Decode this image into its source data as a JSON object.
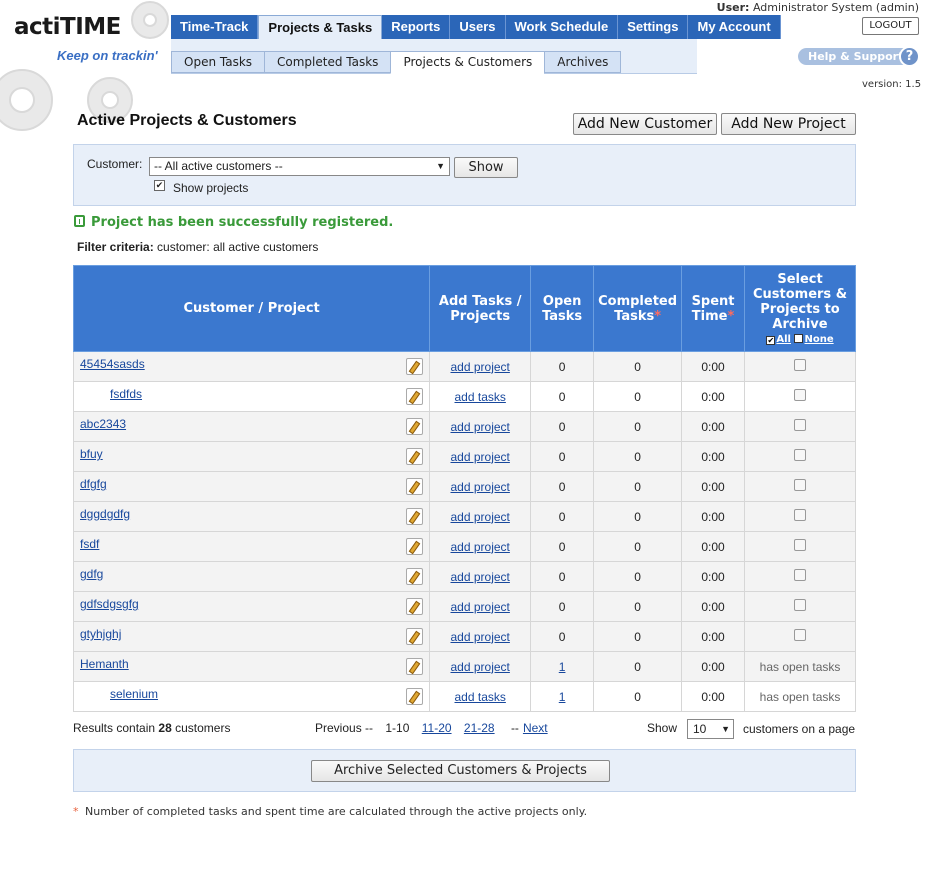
{
  "header": {
    "logo_prefix": "acti",
    "logo_suffix": "TIME",
    "slogan": "Keep on trackin'",
    "user_label": "User:",
    "user_name": "Administrator System (admin)",
    "logout": "LOGOUT",
    "help": "Help & Support",
    "help_icon": "?",
    "version": "version: 1.5"
  },
  "nav": {
    "items": [
      "Time-Track",
      "Projects & Tasks",
      "Reports",
      "Users",
      "Work Schedule",
      "Settings",
      "My Account"
    ],
    "active_index": 1
  },
  "subnav": {
    "tabs": [
      "Open Tasks",
      "Completed Tasks",
      "Projects & Customers",
      "Archives"
    ],
    "active_index": 2
  },
  "page": {
    "title": "Active Projects & Customers",
    "add_customer": "Add New Customer",
    "add_project": "Add New Project"
  },
  "filter": {
    "customer_label": "Customer:",
    "customer_value": "-- All active customers --",
    "show_button": "Show",
    "show_projects_label": "Show projects",
    "show_projects_checked": true
  },
  "message": {
    "success": "Project has been successfully registered.",
    "criteria_label": "Filter criteria:",
    "criteria_value": "customer: all active customers"
  },
  "table": {
    "headers": {
      "name": "Customer / Project",
      "add": "Add Tasks / Projects",
      "open": "Open Tasks",
      "completed": "Completed Tasks",
      "spent": "Spent Time",
      "select": "Select Customers & Projects to Archive",
      "all": "All",
      "none": "None",
      "asterisk": "*"
    },
    "rows": [
      {
        "type": "cust",
        "name": "45454sasds",
        "add": "add project",
        "open": "0",
        "open_link": false,
        "completed": "0",
        "spent": "0:00",
        "archive": "checkbox"
      },
      {
        "type": "proj",
        "name": "fsdfds",
        "add": "add tasks",
        "open": "0",
        "open_link": false,
        "completed": "0",
        "spent": "0:00",
        "archive": "checkbox"
      },
      {
        "type": "cust",
        "name": "abc2343",
        "add": "add project",
        "open": "0",
        "open_link": false,
        "completed": "0",
        "spent": "0:00",
        "archive": "checkbox"
      },
      {
        "type": "cust",
        "name": "bfuy",
        "add": "add project",
        "open": "0",
        "open_link": false,
        "completed": "0",
        "spent": "0:00",
        "archive": "checkbox"
      },
      {
        "type": "cust",
        "name": "dfgfg",
        "add": "add project",
        "open": "0",
        "open_link": false,
        "completed": "0",
        "spent": "0:00",
        "archive": "checkbox"
      },
      {
        "type": "cust",
        "name": "dggdgdfg",
        "add": "add project",
        "open": "0",
        "open_link": false,
        "completed": "0",
        "spent": "0:00",
        "archive": "checkbox"
      },
      {
        "type": "cust",
        "name": "fsdf",
        "add": "add project",
        "open": "0",
        "open_link": false,
        "completed": "0",
        "spent": "0:00",
        "archive": "checkbox"
      },
      {
        "type": "cust",
        "name": "gdfg",
        "add": "add project",
        "open": "0",
        "open_link": false,
        "completed": "0",
        "spent": "0:00",
        "archive": "checkbox"
      },
      {
        "type": "cust",
        "name": "gdfsdgsgfg",
        "add": "add project",
        "open": "0",
        "open_link": false,
        "completed": "0",
        "spent": "0:00",
        "archive": "checkbox"
      },
      {
        "type": "cust",
        "name": "gtyhjghj",
        "add": "add project",
        "open": "0",
        "open_link": false,
        "completed": "0",
        "spent": "0:00",
        "archive": "checkbox"
      },
      {
        "type": "cust",
        "name": "Hemanth",
        "add": "add project",
        "open": "1",
        "open_link": true,
        "completed": "0",
        "spent": "0:00",
        "archive": "has open tasks"
      },
      {
        "type": "proj",
        "name": "selenium",
        "add": "add tasks",
        "open": "1",
        "open_link": true,
        "completed": "0",
        "spent": "0:00",
        "archive": "has open tasks"
      }
    ]
  },
  "pager": {
    "results_prefix": "Results contain",
    "results_count": "28",
    "results_suffix": "customers",
    "previous": "Previous --",
    "page1": "1-10",
    "page2": "11-20",
    "page3": "21-28",
    "next_prefix": "--",
    "next": "Next",
    "show_label": "Show",
    "per_page": "10",
    "per_page_suffix": "customers on a page"
  },
  "archive_button": "Archive Selected Customers & Projects",
  "footnote": {
    "asterisk": "*",
    "text": "Number of completed tasks and spent time are calculated through the active projects only."
  },
  "colors": {
    "nav_blue": "#2b66b8",
    "table_header": "#3b78cf",
    "success_green": "#3a9a3a",
    "link": "#17479c"
  }
}
